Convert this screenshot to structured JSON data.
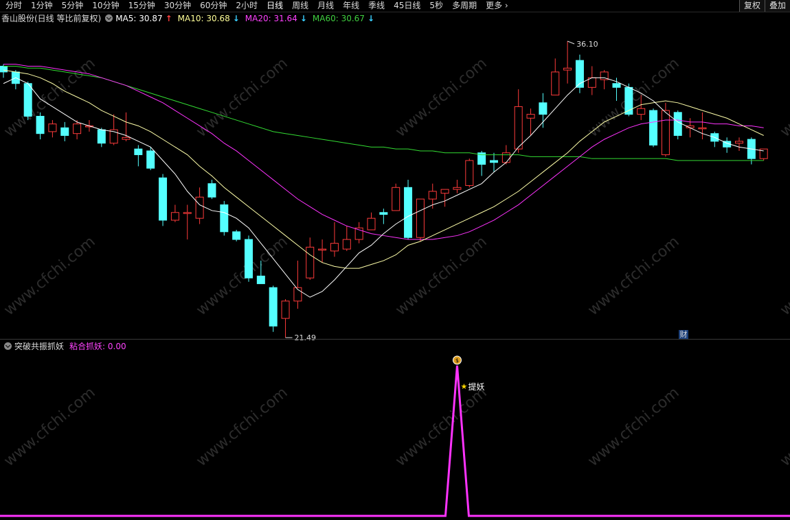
{
  "toolbar": {
    "tabs": [
      "分时",
      "1分钟",
      "5分钟",
      "10分钟",
      "15分钟",
      "30分钟",
      "60分钟",
      "2小时",
      "日线",
      "周线",
      "月线",
      "年线",
      "季线",
      "45日线",
      "5秒",
      "多周期"
    ],
    "active_tab": "日线",
    "more_label": "更多",
    "fuquan_label": "复权",
    "overlay_label": "叠加"
  },
  "main_legend": {
    "stock_label": "香山股份(日线 等比前复权)",
    "ma": [
      {
        "label": "MA5: 30.87",
        "arrow": "↑",
        "color": "#ffffff",
        "arrow_color": "#ff4040"
      },
      {
        "label": "MA10: 30.68",
        "arrow": "↓",
        "color": "#ffff99",
        "arrow_color": "#3ad0ff"
      },
      {
        "label": "MA20: 31.64",
        "arrow": "↓",
        "color": "#ff40ff",
        "arrow_color": "#3ad0ff"
      },
      {
        "label": "MA60: 30.67",
        "arrow": "↓",
        "color": "#40d040",
        "arrow_color": "#3ad0ff"
      }
    ]
  },
  "annotations": {
    "high_label": "36.10",
    "low_label": "21.49",
    "fin_badge": "财"
  },
  "indicator": {
    "name": "突破共振抓妖",
    "value_label": "粘合抓妖: 0.00",
    "signal_label": "提妖",
    "signal_icon": "money-bag-icon",
    "line_color": "#ff33ff"
  },
  "watermark": "www.cfchi.com",
  "colors": {
    "up": "#ff3b3b",
    "down": "#54ffff",
    "ma5": "#ffffff",
    "ma10": "#ffffaa",
    "ma20": "#ff33ff",
    "ma60": "#33dd33"
  },
  "chart_data": {
    "type": "candlestick",
    "price_range": [
      21.49,
      36.1
    ],
    "candles": [
      {
        "o": 34.8,
        "c": 34.5,
        "h": 34.9,
        "l": 34.2
      },
      {
        "o": 34.5,
        "c": 33.9,
        "h": 34.6,
        "l": 33.6
      },
      {
        "o": 33.9,
        "c": 32.2,
        "h": 34.0,
        "l": 32.0
      },
      {
        "o": 32.2,
        "c": 31.3,
        "h": 32.4,
        "l": 31.0
      },
      {
        "o": 31.4,
        "c": 31.8,
        "h": 32.0,
        "l": 31.1
      },
      {
        "o": 31.6,
        "c": 31.2,
        "h": 31.9,
        "l": 30.9
      },
      {
        "o": 31.3,
        "c": 31.8,
        "h": 32.0,
        "l": 31.0
      },
      {
        "o": 31.7,
        "c": 31.7,
        "h": 32.0,
        "l": 31.4
      },
      {
        "o": 31.5,
        "c": 30.8,
        "h": 31.6,
        "l": 30.6
      },
      {
        "o": 30.8,
        "c": 31.5,
        "h": 32.3,
        "l": 30.7
      },
      {
        "o": 31.0,
        "c": 31.1,
        "h": 32.4,
        "l": 30.9
      },
      {
        "o": 30.5,
        "c": 30.2,
        "h": 30.7,
        "l": 29.6
      },
      {
        "o": 30.4,
        "c": 29.5,
        "h": 30.6,
        "l": 29.4
      },
      {
        "o": 29.0,
        "c": 26.8,
        "h": 29.2,
        "l": 26.5
      },
      {
        "o": 26.8,
        "c": 27.2,
        "h": 27.6,
        "l": 26.7
      },
      {
        "o": 27.2,
        "c": 27.2,
        "h": 27.6,
        "l": 25.8
      },
      {
        "o": 26.9,
        "c": 28.0,
        "h": 28.5,
        "l": 26.6
      },
      {
        "o": 28.7,
        "c": 28.0,
        "h": 28.9,
        "l": 27.9
      },
      {
        "o": 27.6,
        "c": 26.2,
        "h": 27.8,
        "l": 26.0
      },
      {
        "o": 26.2,
        "c": 25.8,
        "h": 26.3,
        "l": 25.7
      },
      {
        "o": 25.8,
        "c": 23.8,
        "h": 26.0,
        "l": 23.6
      },
      {
        "o": 23.9,
        "c": 23.5,
        "h": 24.7,
        "l": 23.5
      },
      {
        "o": 23.3,
        "c": 21.3,
        "h": 23.4,
        "l": 21.0
      },
      {
        "o": 21.7,
        "c": 22.6,
        "h": 22.7,
        "l": 20.7
      },
      {
        "o": 22.6,
        "c": 23.3,
        "h": 24.7,
        "l": 22.2
      },
      {
        "o": 23.8,
        "c": 25.4,
        "h": 25.9,
        "l": 23.7
      },
      {
        "o": 25.3,
        "c": 25.3,
        "h": 25.8,
        "l": 24.6
      },
      {
        "o": 25.2,
        "c": 25.6,
        "h": 26.7,
        "l": 24.9
      },
      {
        "o": 25.3,
        "c": 25.8,
        "h": 26.5,
        "l": 25.2
      },
      {
        "o": 25.8,
        "c": 26.4,
        "h": 26.7,
        "l": 25.6
      },
      {
        "o": 26.3,
        "c": 26.9,
        "h": 27.2,
        "l": 26.3
      },
      {
        "o": 27.2,
        "c": 27.1,
        "h": 27.4,
        "l": 26.6
      },
      {
        "o": 27.3,
        "c": 28.5,
        "h": 28.7,
        "l": 27.3
      },
      {
        "o": 28.5,
        "c": 25.9,
        "h": 28.9,
        "l": 25.8
      },
      {
        "o": 25.9,
        "c": 27.9,
        "h": 27.9,
        "l": 25.7
      },
      {
        "o": 27.9,
        "c": 28.3,
        "h": 28.7,
        "l": 27.4
      },
      {
        "o": 28.2,
        "c": 28.4,
        "h": 28.4,
        "l": 27.5
      },
      {
        "o": 28.4,
        "c": 28.5,
        "h": 28.9,
        "l": 28.2
      },
      {
        "o": 28.6,
        "c": 29.9,
        "h": 30.0,
        "l": 28.5
      },
      {
        "o": 30.3,
        "c": 29.7,
        "h": 30.4,
        "l": 29.1
      },
      {
        "o": 29.9,
        "c": 29.8,
        "h": 30.3,
        "l": 29.3
      },
      {
        "o": 29.8,
        "c": 30.3,
        "h": 30.7,
        "l": 29.7
      },
      {
        "o": 30.5,
        "c": 32.7,
        "h": 33.6,
        "l": 30.3
      },
      {
        "o": 32.1,
        "c": 32.3,
        "h": 32.6,
        "l": 31.2
      },
      {
        "o": 32.9,
        "c": 32.3,
        "h": 33.4,
        "l": 31.6
      },
      {
        "o": 33.3,
        "c": 34.5,
        "h": 35.2,
        "l": 33.3
      },
      {
        "o": 34.6,
        "c": 34.7,
        "h": 36.1,
        "l": 33.9
      },
      {
        "o": 35.1,
        "c": 33.7,
        "h": 35.4,
        "l": 33.4
      },
      {
        "o": 33.7,
        "c": 34.2,
        "h": 34.8,
        "l": 33.3
      },
      {
        "o": 34.1,
        "c": 34.5,
        "h": 34.6,
        "l": 33.6
      },
      {
        "o": 33.9,
        "c": 33.7,
        "h": 34.2,
        "l": 33.0
      },
      {
        "o": 33.7,
        "c": 32.3,
        "h": 33.9,
        "l": 32.2
      },
      {
        "o": 32.3,
        "c": 32.6,
        "h": 33.3,
        "l": 32.0
      },
      {
        "o": 32.5,
        "c": 30.7,
        "h": 32.6,
        "l": 30.6
      },
      {
        "o": 30.2,
        "c": 32.5,
        "h": 32.9,
        "l": 30.1
      },
      {
        "o": 32.4,
        "c": 31.2,
        "h": 32.5,
        "l": 31.0
      },
      {
        "o": 31.6,
        "c": 31.7,
        "h": 32.1,
        "l": 31.1
      },
      {
        "o": 31.6,
        "c": 31.6,
        "h": 32.4,
        "l": 31.0
      },
      {
        "o": 31.3,
        "c": 30.9,
        "h": 31.4,
        "l": 30.6
      },
      {
        "o": 30.9,
        "c": 30.6,
        "h": 31.1,
        "l": 30.3
      },
      {
        "o": 30.8,
        "c": 30.9,
        "h": 31.1,
        "l": 30.4
      },
      {
        "o": 31.0,
        "c": 30.0,
        "h": 31.1,
        "l": 29.7
      },
      {
        "o": 30.0,
        "c": 30.5,
        "h": 30.5,
        "l": 29.9
      }
    ],
    "ma5": [
      33.9,
      34.2,
      33.9,
      33.1,
      32.7,
      32.3,
      31.9,
      31.7,
      31.5,
      31.4,
      31.2,
      30.9,
      30.6,
      29.9,
      29.2,
      28.3,
      27.6,
      27.3,
      27.2,
      26.9,
      26.4,
      25.6,
      24.8,
      24.0,
      23.2,
      22.8,
      23.1,
      23.7,
      24.4,
      25.1,
      25.5,
      26.1,
      26.6,
      27.0,
      27.3,
      27.6,
      27.8,
      28.1,
      28.4,
      28.7,
      29.3,
      29.8,
      30.6,
      31.2,
      31.9,
      32.6,
      33.3,
      33.9,
      34.2,
      34.2,
      34.0,
      33.7,
      33.4,
      33.0,
      32.4,
      31.9,
      31.6,
      31.3,
      31.1,
      30.8,
      30.6,
      30.5,
      30.4
    ],
    "ma10": [
      34.6,
      34.5,
      34.4,
      34.2,
      33.9,
      33.5,
      33.2,
      32.9,
      32.5,
      32.2,
      31.9,
      31.7,
      31.4,
      31.0,
      30.6,
      30.2,
      29.6,
      29.1,
      28.5,
      28.0,
      27.5,
      27.0,
      26.5,
      26.0,
      25.5,
      25.0,
      24.6,
      24.4,
      24.3,
      24.3,
      24.5,
      24.7,
      25.0,
      25.5,
      25.7,
      26.0,
      26.3,
      26.6,
      26.9,
      27.2,
      27.5,
      27.9,
      28.3,
      28.8,
      29.3,
      29.8,
      30.3,
      30.9,
      31.4,
      31.9,
      32.2,
      32.5,
      32.8,
      32.9,
      33.0,
      32.9,
      32.7,
      32.5,
      32.3,
      32.1,
      31.8,
      31.5,
      31.2
    ],
    "ma20": [
      34.9,
      34.9,
      34.8,
      34.8,
      34.7,
      34.6,
      34.5,
      34.4,
      34.2,
      34.0,
      33.8,
      33.5,
      33.2,
      32.9,
      32.5,
      32.1,
      31.7,
      31.3,
      30.8,
      30.4,
      29.9,
      29.4,
      28.9,
      28.4,
      27.9,
      27.5,
      27.1,
      26.8,
      26.5,
      26.3,
      26.1,
      26.0,
      25.9,
      25.8,
      25.8,
      25.8,
      25.9,
      26.0,
      26.2,
      26.5,
      26.8,
      27.2,
      27.6,
      28.1,
      28.6,
      29.1,
      29.6,
      30.1,
      30.6,
      31.0,
      31.3,
      31.6,
      31.8,
      31.9,
      32.0,
      32.0,
      31.9,
      31.9,
      31.8,
      31.8,
      31.7,
      31.7,
      31.6
    ],
    "ma60": [
      34.8,
      34.8,
      34.7,
      34.7,
      34.6,
      34.5,
      34.4,
      34.3,
      34.2,
      34.0,
      33.8,
      33.6,
      33.4,
      33.2,
      33.0,
      32.8,
      32.6,
      32.4,
      32.2,
      32.0,
      31.8,
      31.6,
      31.4,
      31.3,
      31.2,
      31.1,
      31.0,
      30.9,
      30.8,
      30.7,
      30.6,
      30.6,
      30.5,
      30.5,
      30.4,
      30.4,
      30.3,
      30.3,
      30.3,
      30.2,
      30.2,
      30.2,
      30.2,
      30.1,
      30.1,
      30.1,
      30.1,
      30.1,
      30.0,
      30.0,
      30.0,
      30.0,
      30.0,
      30.0,
      30.0,
      29.9,
      29.9,
      29.9,
      29.9,
      29.9,
      29.9,
      29.9,
      29.9
    ],
    "indicator_values": {
      "baseline": 0,
      "peak": 1,
      "peak_index": 37
    }
  }
}
